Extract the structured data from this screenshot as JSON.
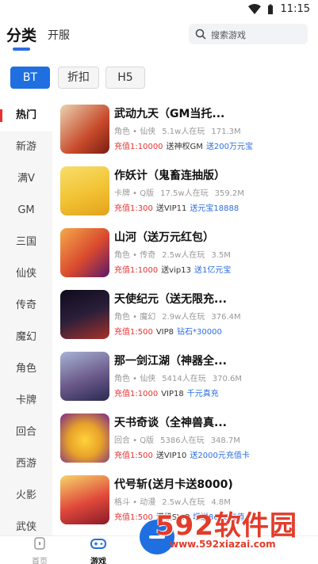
{
  "status_bar": {
    "time": "11:15"
  },
  "top_tabs": {
    "category": "分类",
    "open_server": "开服"
  },
  "search": {
    "placeholder": "搜索游戏"
  },
  "filters": [
    {
      "label": "BT",
      "active": true
    },
    {
      "label": "折扣",
      "active": false
    },
    {
      "label": "H5",
      "active": false
    }
  ],
  "sidebar": {
    "items": [
      {
        "label": "热门",
        "active": true
      },
      {
        "label": "新游"
      },
      {
        "label": "满V"
      },
      {
        "label": "GM"
      },
      {
        "label": "三国"
      },
      {
        "label": "仙侠"
      },
      {
        "label": "传奇"
      },
      {
        "label": "魔幻"
      },
      {
        "label": "角色"
      },
      {
        "label": "卡牌"
      },
      {
        "label": "回合"
      },
      {
        "label": "西游"
      },
      {
        "label": "火影"
      },
      {
        "label": "武侠"
      }
    ]
  },
  "games": [
    {
      "title": "武动九天（GM当托...",
      "genre": "角色 • 仙侠",
      "players": "5.1w人在玩",
      "size": "171.3M",
      "tag1": "充值1:10000",
      "tag2": "送神权GM",
      "tag3": "送200万元宝",
      "thumb_color": "#c84a2b"
    },
    {
      "title": "作妖计（鬼畜连抽版）",
      "genre": "卡牌 • Q版",
      "players": "17.5w人在玩",
      "size": "359.2M",
      "tag1": "充值1:300",
      "tag2": "送VIP11",
      "tag3": "送元宝18888",
      "thumb_color": "#f2c233"
    },
    {
      "title": "山河（送万元红包）",
      "genre": "角色 • 传奇",
      "players": "2.5w人在玩",
      "size": "3.5M",
      "tag1": "充值1:1000",
      "tag2": "送vip13",
      "tag3": "送1亿元宝",
      "thumb_color": "#d9492f"
    },
    {
      "title": "天使纪元（送无限充...",
      "genre": "角色 • 魔幻",
      "players": "2.9w人在玩",
      "size": "376.4M",
      "tag1": "充值1:500",
      "tag2": "VIP8",
      "tag3": "钻石*30000",
      "thumb_color": "#2b1f3a"
    },
    {
      "title": "那一剑江湖（神器全...",
      "genre": "角色 • 仙侠",
      "players": "5414人在玩",
      "size": "370.6M",
      "tag1": "充值1:1000",
      "tag2": "VIP18",
      "tag3": "千元真充",
      "thumb_color": "#6b5a8a"
    },
    {
      "title": "天书奇谈（全神兽真...",
      "genre": "回合 • Q版",
      "players": "5386人在玩",
      "size": "348.7M",
      "tag1": "充值1:500",
      "tag2": "送VIP10",
      "tag3": "送2000元充值卡",
      "thumb_color": "#e8a22a"
    },
    {
      "title": "代号斩(送月卡送8000)",
      "genre": "格斗 • 动漫",
      "players": "2.5w人在玩",
      "size": "4.8M",
      "tag1": "充值1:500",
      "tag2": "满级SVIP",
      "tag3": "增送8000充值",
      "thumb_color": "#e0483a"
    }
  ],
  "bottom_nav": [
    {
      "label": "首页",
      "icon": "home-icon"
    },
    {
      "label": "游戏",
      "icon": "gamepad-icon",
      "active": true
    }
  ],
  "watermark": {
    "brand": "592软件园",
    "url": "www.592xiazai.com"
  }
}
